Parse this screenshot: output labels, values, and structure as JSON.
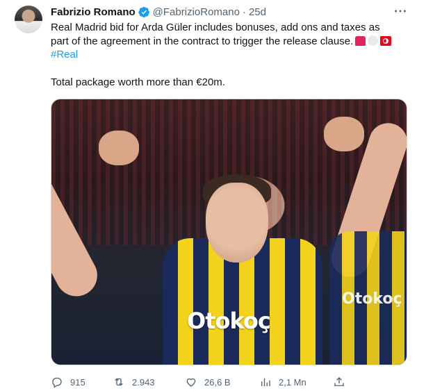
{
  "author": {
    "name": "Fabrizio Romano",
    "handle": "@FabrizioRomano",
    "separator": "·",
    "age": "25d"
  },
  "tweet": {
    "line1": "Real Madrid bid for Arda Güler includes bonuses, add ons and taxes as",
    "line2": "part of the agreement in the contract to trigger the release clause.",
    "hashtag": "#Real",
    "line4": "Total package worth more than €20m.",
    "emojis": [
      "siren-emoji",
      "white-circle-emoji",
      "turkey-flag-emoji"
    ]
  },
  "media": {
    "sponsor_text": "Otokoç",
    "sponsor_text_2": "Otokoç"
  },
  "actions": {
    "replies": "915",
    "retweets": "2.943",
    "likes": "26,6 B",
    "views": "2,1 Mn"
  },
  "icons": {
    "more": "more-icon",
    "verified": "verified-badge-icon",
    "reply": "reply-icon",
    "retweet": "retweet-icon",
    "like": "heart-icon",
    "views": "views-icon",
    "share": "share-icon"
  },
  "colors": {
    "link": "#1d9bf0",
    "muted": "#536471",
    "text": "#0f1419"
  }
}
